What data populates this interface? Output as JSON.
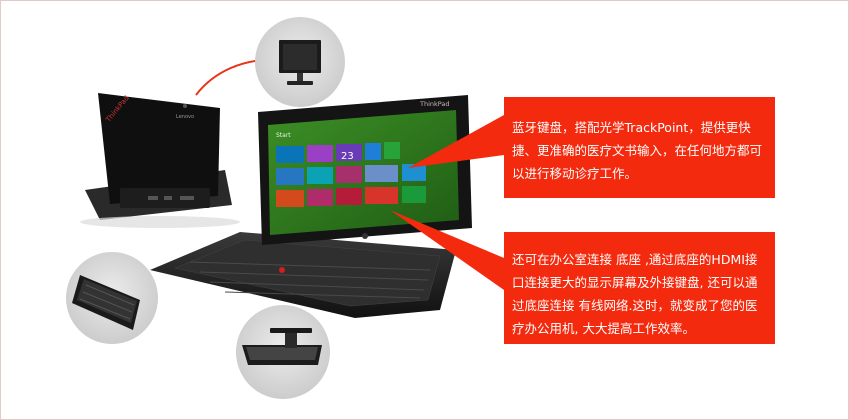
{
  "callouts": {
    "keyboard": "蓝牙键盘，搭配光学TrackPoint，提供更快捷、更准确的医疗文书输入，在任何地方都可以进行移动诊疗工作。",
    "dock": "还可在办公室连接  底座 ,通过底座的HDMI接口连接更大的显示屏幕及外接键盘, 还可以通过底座连接  有线网络.这时，就变成了您的医疗办公用机, 大大提高工作效率。"
  },
  "tablet": {
    "brand": "ThinkPad",
    "start_label": "Start",
    "tile_number": "23"
  },
  "dock_tablet": {
    "brand": "ThinkPad",
    "oem": "Lenovo"
  },
  "colors": {
    "callout_bg": "#f42a0e",
    "connector_line": "#e8321a",
    "screen_bg": "#2a7a1c"
  }
}
